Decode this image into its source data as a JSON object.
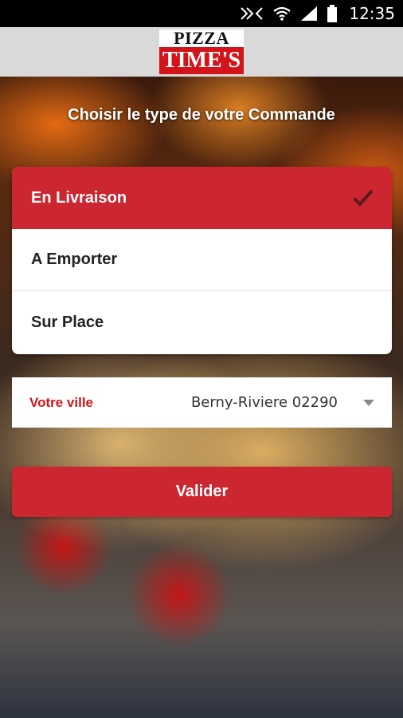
{
  "status_bar": {
    "time": "12:35",
    "icons": [
      "nfc-icon",
      "wifi-icon",
      "signal-icon",
      "battery-icon"
    ]
  },
  "header": {
    "logo_line1": "PIZZA",
    "logo_line2": "TIME'S",
    "brand_color": "#d3141a"
  },
  "main": {
    "heading": "Choisir le type de votre Commande",
    "order_types": [
      {
        "label": "En Livraison",
        "selected": true
      },
      {
        "label": "A Emporter",
        "selected": false
      },
      {
        "label": "Sur Place",
        "selected": false
      }
    ],
    "city": {
      "label": "Votre ville",
      "value": "Berny-Riviere 02290"
    },
    "submit_label": "Valider",
    "accent": "#cc2630"
  }
}
